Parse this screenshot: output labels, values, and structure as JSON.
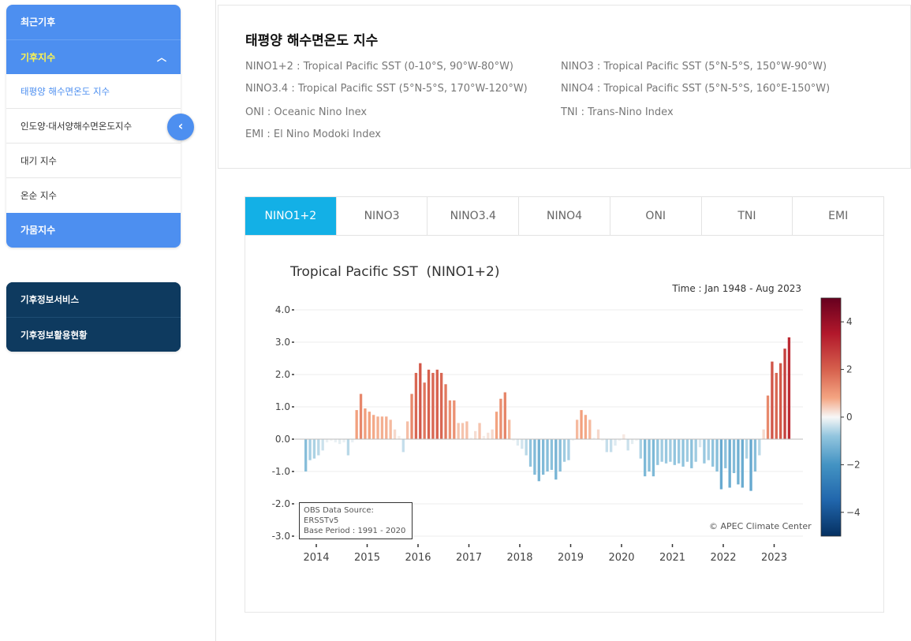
{
  "sidebar": {
    "items": [
      {
        "label": "최근기후"
      },
      {
        "label": "기후지수"
      },
      {
        "label": "태평양 해수면온도 지수"
      },
      {
        "label": "인도양·대서양해수면온도지수"
      },
      {
        "label": "대기 지수"
      },
      {
        "label": "온순 지수"
      },
      {
        "label": "가뭄지수"
      }
    ],
    "services": [
      {
        "label": "기후정보서비스"
      },
      {
        "label": "기후정보활용현황"
      }
    ]
  },
  "header": {
    "title": "태평양 해수면온도 지수",
    "definitions": [
      "NINO1+2 : Tropical Pacific SST (0-10°S, 90°W-80°W)",
      "NINO3 : Tropical Pacific SST (5°N-5°S, 150°W-90°W)",
      "NINO3.4 : Tropical Pacific SST (5°N-5°S, 170°W-120°W)",
      "NINO4 : Tropical Pacific SST (5°N-5°S, 160°E-150°W)",
      "ONI : Oceanic Nino Inex",
      "TNI : Trans-Nino Index",
      "EMI : El Nino Modoki Index"
    ]
  },
  "tabs": [
    "NINO1+2",
    "NINO3",
    "NINO3.4",
    "NINO4",
    "ONI",
    "TNI",
    "EMI"
  ],
  "chart_info": {
    "time": "Time : Jan 1948 - Aug 2023",
    "source_line1": "OBS Data Source: ERSSTv5",
    "source_line2": "Base Period : 1991 - 2020",
    "copyright": "© APEC Climate Center"
  },
  "chart_data": {
    "type": "bar",
    "title": "Tropical Pacific SST  (NINO1+2)",
    "x_start": "Jan 2014",
    "x_ticks": [
      "2014",
      "2015",
      "2016",
      "2017",
      "2018",
      "2019",
      "2020",
      "2021",
      "2022",
      "2023"
    ],
    "y_ticks": [
      "4.0",
      "3.0",
      "2.0",
      "1.0",
      "0.0",
      "-1.0",
      "-2.0",
      "-3.0"
    ],
    "ylim": [
      -3,
      4
    ],
    "colorbar": {
      "range": [
        -5,
        5
      ],
      "ticks": [
        "4",
        "2",
        "0",
        "−2",
        "−4"
      ]
    },
    "values": [
      -1.0,
      -0.65,
      -0.6,
      -0.5,
      -0.35,
      -0.1,
      -0.05,
      -0.1,
      -0.15,
      -0.1,
      -0.5,
      -0.1,
      0.9,
      1.4,
      0.95,
      0.85,
      0.75,
      0.7,
      0.7,
      0.7,
      0.6,
      0.3,
      0.1,
      -0.4,
      0.55,
      1.4,
      2.05,
      2.35,
      1.75,
      2.15,
      2.05,
      2.15,
      2.05,
      1.7,
      1.2,
      1.2,
      0.5,
      0.5,
      0.55,
      0.05,
      0.25,
      0.5,
      0.1,
      0.2,
      0.3,
      0.85,
      1.25,
      1.45,
      0.6,
      -0.05,
      -0.2,
      -0.3,
      -0.5,
      -0.85,
      -1.1,
      -1.3,
      -1.1,
      -1.0,
      -0.95,
      -1.25,
      -1.0,
      -0.7,
      -0.65,
      -0.05,
      0.6,
      0.9,
      0.75,
      0.6,
      0.05,
      0.3,
      -0.05,
      -0.4,
      -0.4,
      -0.2,
      -0.05,
      0.15,
      -0.35,
      -0.15,
      -0.05,
      -0.6,
      -1.15,
      -1.0,
      -1.15,
      -0.8,
      -0.7,
      -0.75,
      -0.7,
      -0.8,
      -0.75,
      -0.85,
      -0.7,
      -0.9,
      -0.7,
      -0.25,
      -0.75,
      -0.65,
      -0.85,
      -1.0,
      -1.55,
      -0.9,
      -1.5,
      -1.05,
      -1.4,
      -1.5,
      -0.6,
      -1.6,
      -1.0,
      -0.5,
      0.3,
      1.35,
      2.4,
      2.05,
      2.35,
      2.8,
      3.15
    ]
  }
}
